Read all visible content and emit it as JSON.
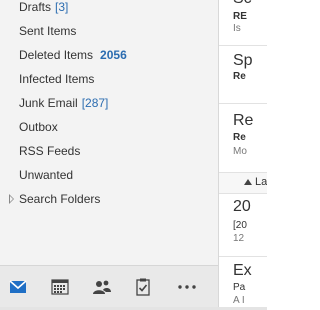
{
  "folders": [
    {
      "label": "Drafts",
      "count": "[3]"
    },
    {
      "label": "Sent Items"
    },
    {
      "label": "Deleted Items",
      "count": "2056"
    },
    {
      "label": "Infected Items"
    },
    {
      "label": "Junk Email",
      "count": "[287]"
    },
    {
      "label": "Outbox"
    },
    {
      "label": "RSS Feeds"
    },
    {
      "label": "Unwanted"
    },
    {
      "label": "Search Folders"
    }
  ],
  "nav": {
    "icons": [
      "mail-icon",
      "calendar-icon",
      "people-icon",
      "tasks-icon",
      "more-icon"
    ],
    "active": "mail",
    "more_label": "···"
  },
  "messages": {
    "frag1_title": "Sc",
    "frag1_sender": "RE",
    "frag1_preview": "Is",
    "frag2_title": "Sp",
    "frag2_sender": "Re",
    "frag3_title": "Re",
    "frag3_sender": "Re",
    "frag3_preview": "Mo",
    "group_label": "La",
    "frag4_title": "20",
    "frag4_sender": "[20",
    "frag4_preview": "12",
    "frag5_title": "Ex",
    "frag5_sender": "Pa",
    "frag5_preview": "A I"
  },
  "colors": {
    "accent": "#2b6cb0",
    "pane_bg": "#f3f3f3",
    "nav_bg": "#e9e9e9"
  }
}
